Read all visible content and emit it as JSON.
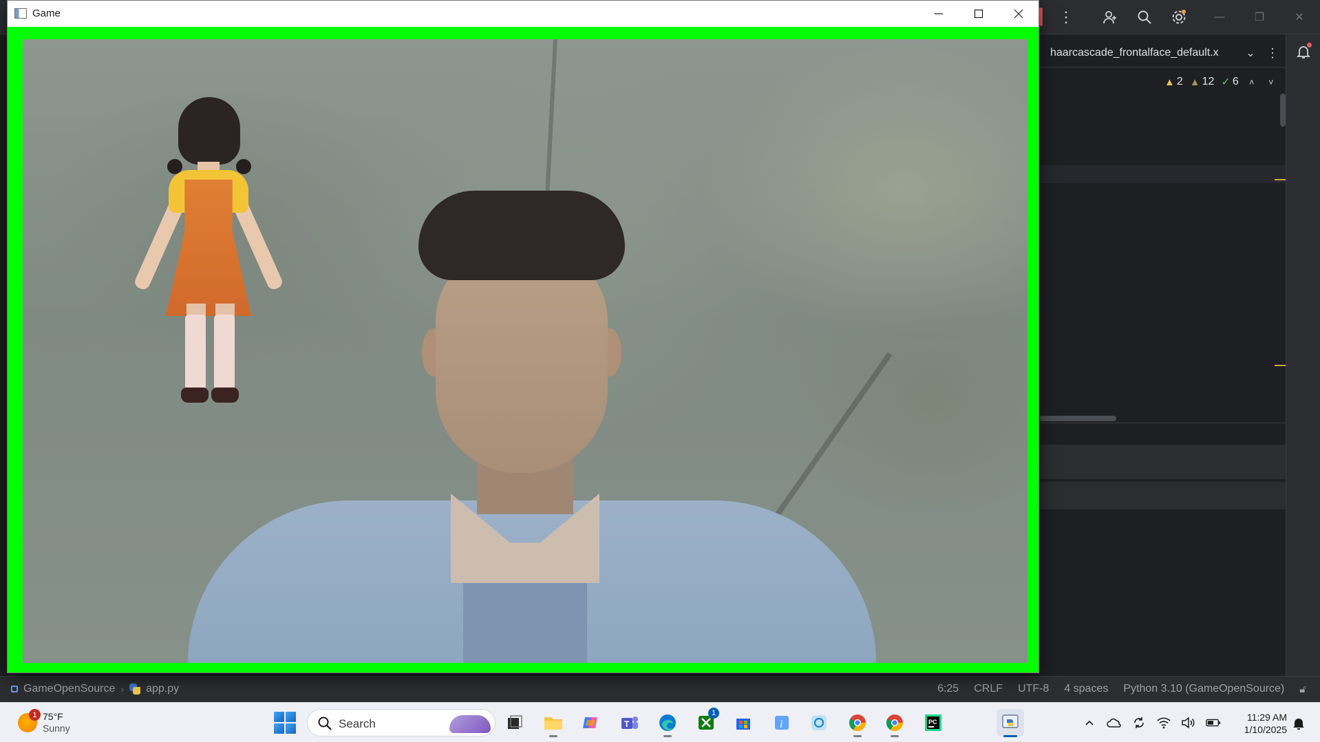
{
  "game_window": {
    "title": "Game",
    "border_color": "#00ff00"
  },
  "ide": {
    "file_tab": "haarcascade_frontalface_default.x",
    "inspections": {
      "warnings": "2",
      "weak_warnings": "12",
      "ok": "6"
    }
  },
  "statusbar": {
    "breadcrumb": [
      "GameOpenSource",
      "app.py"
    ],
    "caret": "6:25",
    "line_sep": "CRLF",
    "encoding": "UTF-8",
    "indent": "4 spaces",
    "interpreter": "Python 3.10 (GameOpenSource)"
  },
  "taskbar": {
    "weather": {
      "temp": "75°F",
      "condition": "Sunny",
      "badge": "1"
    },
    "search_label": "Search",
    "apps": [
      {
        "name": "task-view",
        "icon": "task-view-icon"
      },
      {
        "name": "file-explorer",
        "icon": "folder-icon"
      },
      {
        "name": "copilot",
        "icon": "copilot-icon"
      },
      {
        "name": "teams",
        "icon": "teams-icon"
      },
      {
        "name": "edge",
        "icon": "edge-icon"
      },
      {
        "name": "xbox",
        "icon": "xbox-icon",
        "badge": "1"
      },
      {
        "name": "microsoft-store",
        "icon": "store-icon"
      },
      {
        "name": "info-app",
        "icon": "info-icon"
      },
      {
        "name": "app-circle",
        "icon": "circle-app-icon"
      },
      {
        "name": "chrome-profile-1",
        "icon": "chrome-icon"
      },
      {
        "name": "chrome-profile-2",
        "icon": "chrome-icon"
      },
      {
        "name": "pycharm",
        "icon": "pycharm-icon"
      },
      {
        "name": "python-game",
        "icon": "python-icon",
        "active": true
      }
    ],
    "clock": {
      "time": "11:29 AM",
      "date": "1/10/2025"
    }
  }
}
